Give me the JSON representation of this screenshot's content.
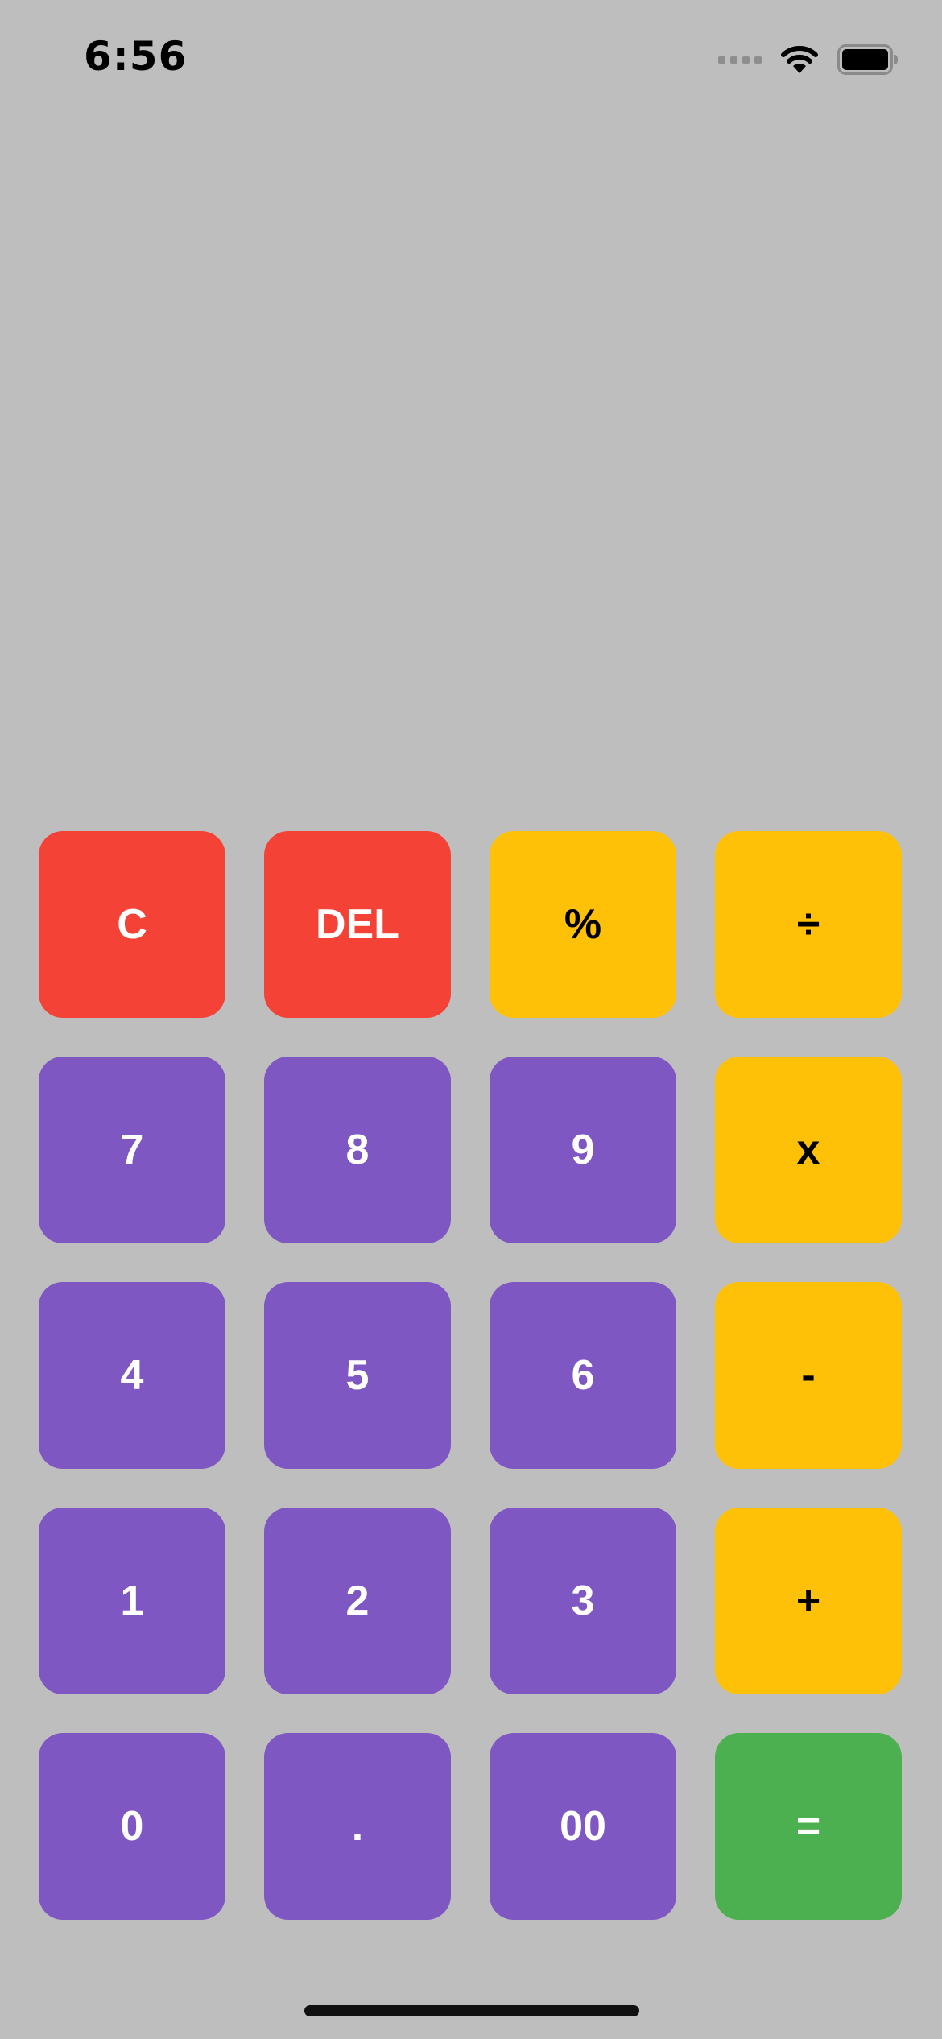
{
  "status_bar": {
    "time": "6:56",
    "signal_icon": "signal-dots-icon",
    "wifi_icon": "wifi-icon",
    "battery_icon": "battery-icon"
  },
  "display": {
    "value": ""
  },
  "keys": {
    "row1": [
      "C",
      "DEL",
      "%",
      "÷"
    ],
    "row2": [
      "7",
      "8",
      "9",
      "x"
    ],
    "row3": [
      "4",
      "5",
      "6",
      "-"
    ],
    "row4": [
      "1",
      "2",
      "3",
      "+"
    ],
    "row5": [
      "0",
      ".",
      "00",
      "="
    ]
  },
  "colors": {
    "background": "#bebebe",
    "clear_keys": "#f44336",
    "operator_keys": "#ffc107",
    "number_keys": "#7e57c2",
    "equals_key": "#4caf50"
  }
}
